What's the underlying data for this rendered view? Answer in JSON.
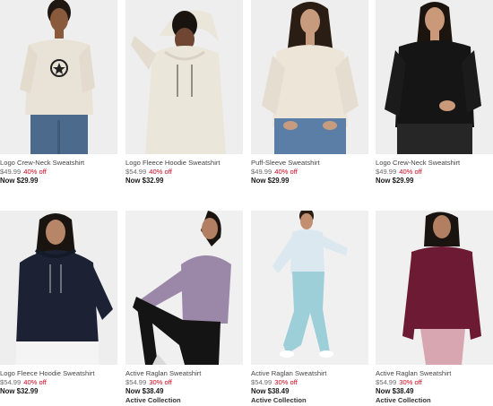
{
  "products": [
    {
      "name": "Logo Crew-Neck Sweatshirt",
      "original_price": "$49.99",
      "discount": "40% off",
      "now_price": "Now $29.99",
      "collection": "",
      "image": "woman-cream-logo-crewneck",
      "colors": {
        "bg": "#eeeeee",
        "top": "#e9e2d6",
        "bottom": "#4b6a8c",
        "skin": "#8a5a3c",
        "hair": "#1f1712"
      }
    },
    {
      "name": "Logo Fleece Hoodie Sweatshirt",
      "original_price": "$54.99",
      "discount": "40% off",
      "now_price": "Now $32.99",
      "collection": "",
      "image": "woman-cream-hoodie",
      "colors": {
        "bg": "#eeeeee",
        "top": "#ebe6da",
        "bottom": "#ebe6da",
        "skin": "#6e4632",
        "hair": "#1a1410"
      }
    },
    {
      "name": "Puff-Sleeve Sweatshirt",
      "original_price": "$49.99",
      "discount": "40% off",
      "now_price": "Now $29.99",
      "collection": "",
      "image": "woman-cream-puff-sleeve",
      "colors": {
        "bg": "#eeeeee",
        "top": "#ece5d8",
        "bottom": "#5b7ea6",
        "skin": "#c69b7e",
        "hair": "#2a1d14"
      }
    },
    {
      "name": "Logo Crew-Neck Sweatshirt",
      "original_price": "$49.99",
      "discount": "40% off",
      "now_price": "Now $29.99",
      "collection": "",
      "image": "woman-black-crewneck",
      "colors": {
        "bg": "#eeeeee",
        "top": "#151515",
        "bottom": "#262626",
        "skin": "#c9997a",
        "hair": "#1c140f"
      }
    },
    {
      "name": "Logo Fleece Hoodie Sweatshirt",
      "original_price": "$54.99",
      "discount": "40% off",
      "now_price": "Now $32.99",
      "collection": "",
      "image": "woman-navy-hoodie",
      "colors": {
        "bg": "#eeeeee",
        "top": "#1c2233",
        "bottom": "#f4f4f4",
        "skin": "#b78567",
        "hair": "#1a1410"
      }
    },
    {
      "name": "Active Raglan Sweatshirt",
      "original_price": "$54.99",
      "discount": "30% off",
      "now_price": "Now $38.49",
      "collection": "Active Collection",
      "image": "woman-lavender-raglan-stretch",
      "colors": {
        "bg": "#f0f0f0",
        "top": "#9b88a8",
        "bottom": "#141414",
        "skin": "#b27f63",
        "hair": "#1a1410"
      }
    },
    {
      "name": "Active Raglan Sweatshirt",
      "original_price": "$54.99",
      "discount": "30% off",
      "now_price": "Now $38.49",
      "collection": "Active Collection",
      "image": "woman-lightblue-raglan-stretch",
      "colors": {
        "bg": "#f0f0f0",
        "top": "#dbe8ef",
        "bottom": "#9ccfd8",
        "skin": "#c29071",
        "hair": "#2a1d14"
      }
    },
    {
      "name": "Active Raglan Sweatshirt",
      "original_price": "$54.99",
      "discount": "30% off",
      "now_price": "Now $38.49",
      "collection": "Active Collection",
      "image": "woman-maroon-raglan",
      "colors": {
        "bg": "#f0f0f0",
        "top": "#6d1a34",
        "bottom": "#d8a6b0",
        "skin": "#b27f63",
        "hair": "#1a1410"
      }
    }
  ]
}
